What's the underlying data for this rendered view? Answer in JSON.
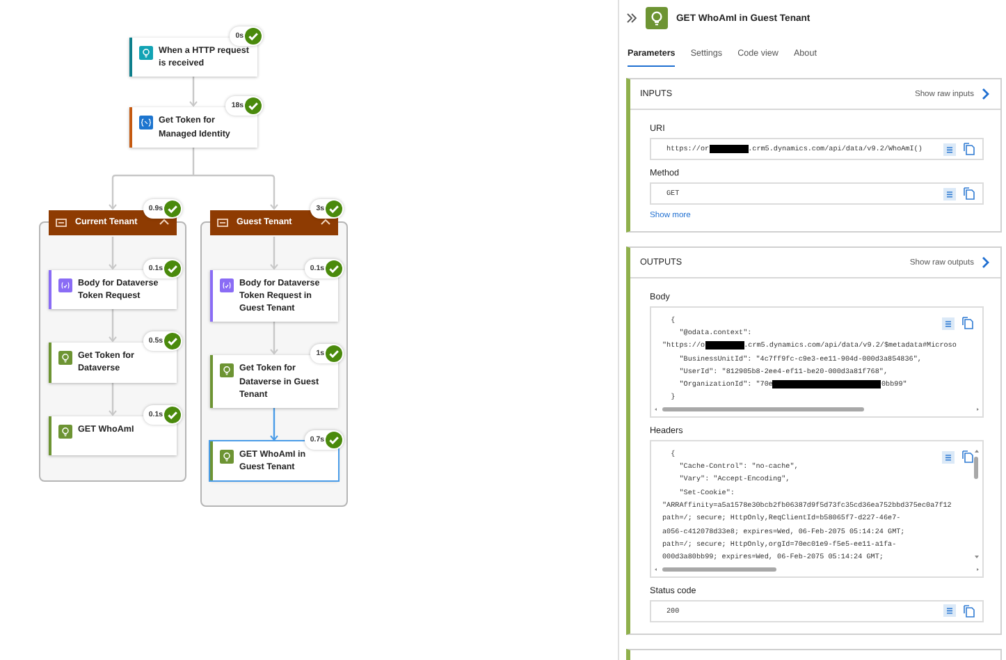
{
  "flow": {
    "steps": [
      {
        "title": "When a HTTP request is received",
        "duration": "0s",
        "kind": "request",
        "selected": false
      },
      {
        "title": "Get Token for Managed Identity",
        "duration": "18s",
        "kind": "identity",
        "selected": false
      }
    ],
    "scopes": [
      {
        "title": "Current Tenant",
        "duration": "0.9s",
        "expanded": true,
        "actions": [
          {
            "title": "Body for Dataverse Token Request",
            "duration": "0.1s",
            "kind": "compose",
            "selected": false
          },
          {
            "title": "Get Token for Dataverse",
            "duration": "0.5s",
            "kind": "http",
            "selected": false
          },
          {
            "title": "GET WhoAmI",
            "duration": "0.1s",
            "kind": "http",
            "selected": false
          }
        ]
      },
      {
        "title": "Guest Tenant",
        "duration": "3s",
        "expanded": true,
        "actions": [
          {
            "title": "Body for Dataverse Token Request in Guest Tenant",
            "duration": "0.1s",
            "kind": "compose",
            "selected": false
          },
          {
            "title": "Get Token for Dataverse in Guest Tenant",
            "duration": "1s",
            "kind": "http",
            "selected": false
          },
          {
            "title": "GET WhoAmI in Guest Tenant",
            "duration": "0.7s",
            "kind": "http",
            "selected": true
          }
        ]
      }
    ]
  },
  "panel": {
    "title": "GET WhoAmI in Guest Tenant",
    "tabs": [
      {
        "label": "Parameters",
        "selected": true
      },
      {
        "label": "Settings",
        "selected": false
      },
      {
        "label": "Code view",
        "selected": false
      },
      {
        "label": "About",
        "selected": false
      }
    ],
    "sections": [
      {
        "title": "INPUTS",
        "raw_link": "Show raw inputs",
        "fields": [
          {
            "label": "URI",
            "kind": "text",
            "lines": [
              [
                {
                  "kind": "text",
                  "text": "https://or"
                },
                {
                  "kind": "redaction"
                },
                {
                  "kind": "text",
                  "text": ".crm5.dynamics.com/api/data/v9.2/WhoAmI()"
                }
              ]
            ]
          },
          {
            "label": "Method",
            "kind": "text",
            "lines": [
              [
                {
                  "kind": "text",
                  "text": "GET"
                }
              ]
            ]
          }
        ],
        "more_link": "Show more"
      },
      {
        "title": "OUTPUTS",
        "raw_link": "Show raw outputs",
        "fields": [
          {
            "label": "Body",
            "kind": "code",
            "lines": [
              [
                {
                  "kind": "text",
                  "text": "  {"
                }
              ],
              [
                {
                  "kind": "text",
                  "text": "    \"@odata.context\":"
                }
              ],
              [
                {
                  "kind": "text",
                  "text": "\"https://o"
                },
                {
                  "kind": "redaction"
                },
                {
                  "kind": "text",
                  "text": ".crm5.dynamics.com/api/data/v9.2/$metadata#Microso"
                }
              ],
              [
                {
                  "kind": "text",
                  "text": "    \"BusinessUnitId\": \"4c7ff9fc-c9e3-ee11-904d-000d3a854836\","
                }
              ],
              [
                {
                  "kind": "text",
                  "text": "    \"UserId\": \"812905b8-2ee4-ef11-be20-000d3a81f768\","
                }
              ],
              [
                {
                  "kind": "text",
                  "text": "    \"OrganizationId\": \"70e"
                },
                {
                  "kind": "redaction"
                },
                {
                  "kind": "text",
                  "text": "0bb99\""
                }
              ],
              [
                {
                  "kind": "text",
                  "text": "  }"
                }
              ]
            ]
          },
          {
            "label": "Headers",
            "kind": "code_tall",
            "lines": [
              [
                {
                  "kind": "text",
                  "text": "  {"
                }
              ],
              [
                {
                  "kind": "text",
                  "text": "    \"Cache-Control\": \"no-cache\","
                }
              ],
              [
                {
                  "kind": "text",
                  "text": "    \"Vary\": \"Accept-Encoding\","
                }
              ],
              [
                {
                  "kind": "text",
                  "text": "    \"Set-Cookie\":"
                }
              ],
              [
                {
                  "kind": "text",
                  "text": "\"ARRAffinity=a5a1578e30bcb2fb06387d9f5d73fc35cd36ea752bbd375ec0a7f12"
                }
              ],
              [
                {
                  "kind": "text",
                  "text": "path=/; secure; HttpOnly,ReqClientId=b58065f7-d227-46e7-"
                }
              ],
              [
                {
                  "kind": "text",
                  "text": "a056-c412078d33e8; expires=Wed, 06-Feb-2075 05:14:24 GMT;"
                }
              ],
              [
                {
                  "kind": "text",
                  "text": "path=/; secure; HttpOnly,orgId=70ec01e9-f5e5-ee11-a1fa-"
                }
              ],
              [
                {
                  "kind": "text",
                  "text": "000d3a80bb99; expires=Wed, 06-Feb-2075 05:14:24 GMT;"
                }
              ]
            ]
          },
          {
            "label": "Status code",
            "kind": "text",
            "lines": [
              [
                {
                  "kind": "text",
                  "text": "200"
                }
              ]
            ]
          }
        ]
      }
    ]
  }
}
